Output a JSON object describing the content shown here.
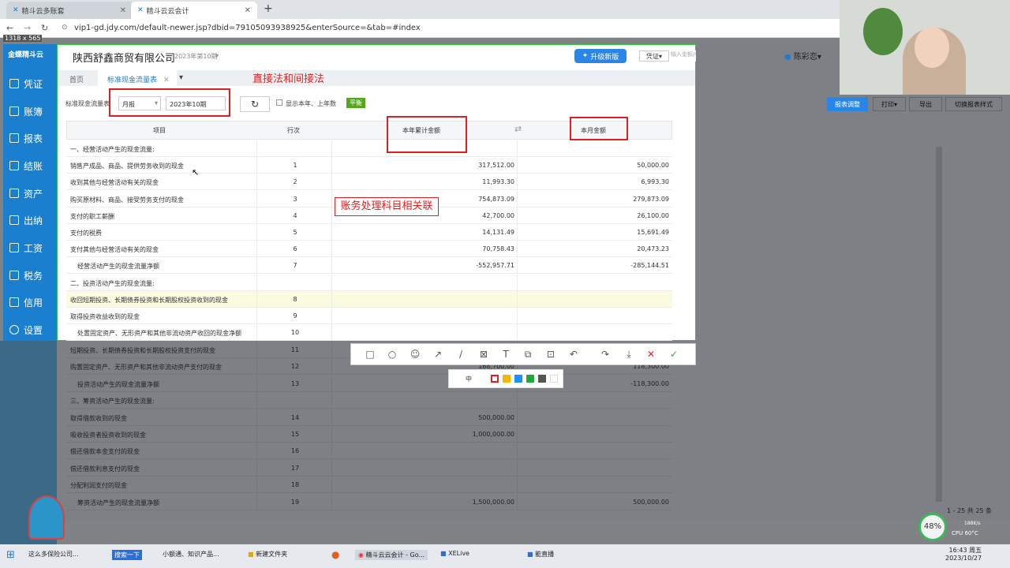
{
  "browser": {
    "tabs": [
      {
        "label": "精斗云多账套",
        "active": false
      },
      {
        "label": "精斗云云会计",
        "active": true
      }
    ],
    "url": "vip1-gd.jdy.com/default-newer.jsp?dbid=79105093938925&enterSource=&tab=#index",
    "size_overlay": "1318 x 565"
  },
  "sidebar": {
    "logo": "金蝶精斗云",
    "items": [
      "凭证",
      "账簿",
      "报表",
      "结账",
      "资产",
      "出纳",
      "工资",
      "税务",
      "信用",
      "设置"
    ]
  },
  "header": {
    "company": "陕西舒鑫商贸有限公司",
    "period": "2023年第10期",
    "upgrade": "升级新版",
    "voucher_menu": "凭证",
    "search_placeholder": "输入金额/科目/摘要",
    "user": "陈彩恋"
  },
  "tabs": {
    "home": "首页",
    "current": "标准现金流量表"
  },
  "toolbar": {
    "report_label": "标准现金流量表",
    "period_type": "月报",
    "period": "2023年10期",
    "show_checkbox": "显示本年、上年数",
    "balance_badge": "平衡",
    "adjust": "报表调整",
    "print": "打印",
    "export": "导出",
    "switch_style": "切换报表样式"
  },
  "annotations": {
    "title": "直接法和间接法",
    "subject": "账务处理科目相关联"
  },
  "table": {
    "headers": {
      "item": "项目",
      "line": "行次",
      "year": "本年累计金额",
      "month": "本月金额"
    },
    "rows": [
      {
        "item": "一、经营活动产生的现金流量:",
        "line": "",
        "year": "",
        "month": ""
      },
      {
        "item": "销售产成品、商品、提供劳务收到的现金",
        "line": "1",
        "year": "317,512.00",
        "month": "50,000.00"
      },
      {
        "item": "收到其他与经营活动有关的现金",
        "line": "2",
        "year": "11,993.30",
        "month": "6,993.30"
      },
      {
        "item": "购买原材料、商品、接受劳务支付的现金",
        "line": "3",
        "year": "754,873.09",
        "month": "279,873.09"
      },
      {
        "item": "支付的职工薪酬",
        "line": "4",
        "year": "42,700.00",
        "month": "26,100.00"
      },
      {
        "item": "支付的税费",
        "line": "5",
        "year": "14,131.49",
        "month": "15,691.49"
      },
      {
        "item": "支付其他与经营活动有关的现金",
        "line": "6",
        "year": "70,758.43",
        "month": "20,473.23"
      },
      {
        "item": "经营活动产生的现金流量净额",
        "line": "7",
        "year": "-552,957.71",
        "month": "-285,144.51"
      },
      {
        "item": "二、投资活动产生的现金流量:",
        "line": "",
        "year": "",
        "month": ""
      },
      {
        "item": "收回短期投资、长期债券投资和长期股权投资收到的现金",
        "line": "8",
        "year": "",
        "month": ""
      },
      {
        "item": "取得投资收益收到的现金",
        "line": "9",
        "year": "",
        "month": ""
      },
      {
        "item": "处置固定资产、无形资产和其他非流动资产收回的现金净额",
        "line": "10",
        "year": "",
        "month": ""
      }
    ],
    "dim_rows": [
      {
        "item": "短期投资、长期债券投资和长期股权投资支付的现金",
        "line": "11",
        "year": "",
        "month": ""
      },
      {
        "item": "购置固定资产、无形资产和其他非流动资产支付的现金",
        "line": "12",
        "year": "168,700.00",
        "month": "118,300.00"
      },
      {
        "item": "投资活动产生的现金流量净额",
        "line": "13",
        "year": "",
        "month": "-118,300.00"
      },
      {
        "item": "三、筹资活动产生的现金流量:",
        "line": "",
        "year": "",
        "month": ""
      },
      {
        "item": "取得借款收到的现金",
        "line": "14",
        "year": "500,000.00",
        "month": ""
      },
      {
        "item": "吸收投资者投资收到的现金",
        "line": "15",
        "year": "1,000,000.00",
        "month": ""
      },
      {
        "item": "偿还借款本金支付的现金",
        "line": "16",
        "year": "",
        "month": ""
      },
      {
        "item": "偿还借款利息支付的现金",
        "line": "17",
        "year": "",
        "month": ""
      },
      {
        "item": "分配利润支付的现金",
        "line": "18",
        "year": "",
        "month": ""
      },
      {
        "item": "筹资活动产生的现金流量净额",
        "line": "19",
        "year": "1,500,000.00",
        "month": "500,000.00"
      }
    ]
  },
  "pagination": "1 - 25  共 25 条",
  "screenshot_tool": {
    "size_label": "中"
  },
  "system": {
    "cpu_percent": "48%",
    "net": "188K/s",
    "cpu_temp": "CPU 60°C",
    "time": "16:43 周五",
    "date": "2023/10/27"
  },
  "taskbar": {
    "items": [
      "这么多保险公司...",
      "搜索一下",
      "小额通、知识产品...",
      "新建文件夹",
      "精斗云云会计 - Go...",
      "XELive",
      "能直播"
    ]
  }
}
